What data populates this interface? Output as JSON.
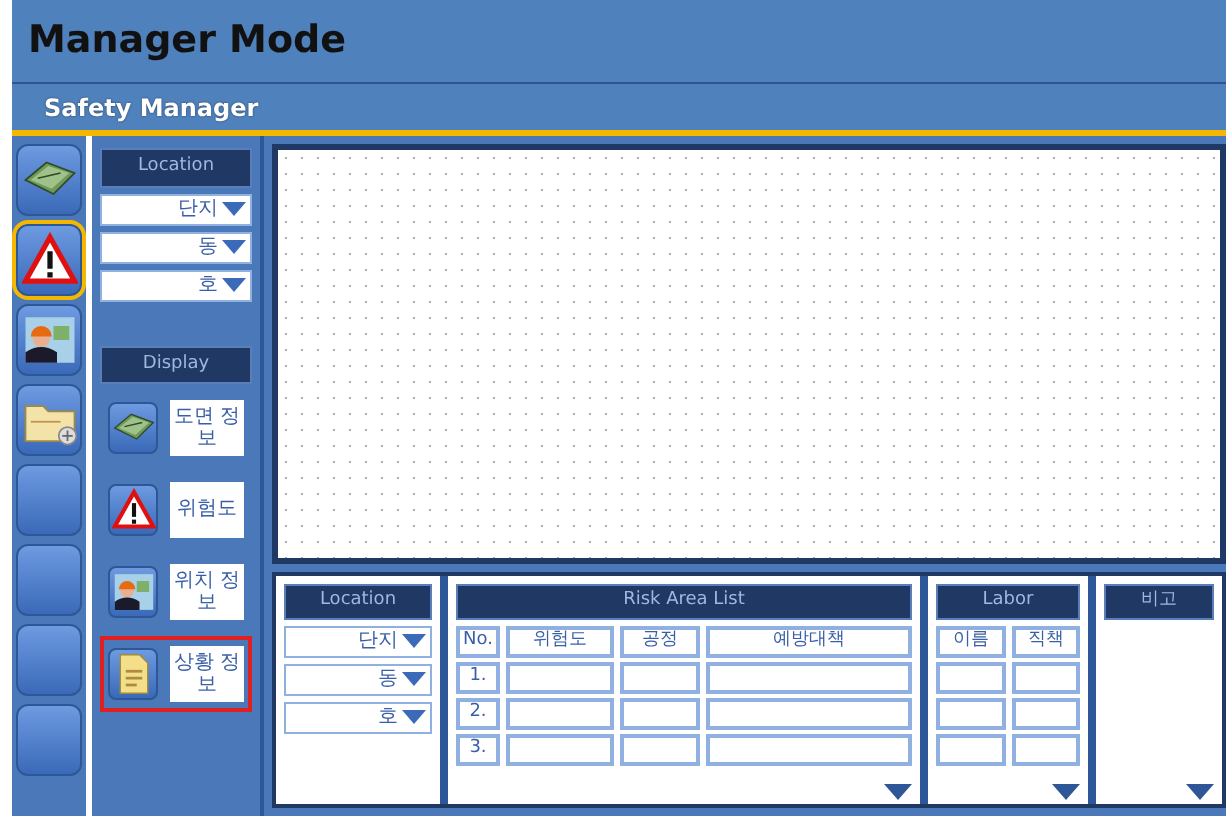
{
  "header": {
    "title": "Manager Mode",
    "subtitle": "Safety Manager"
  },
  "rail": [
    {
      "kind": "blueprint",
      "selected": false
    },
    {
      "kind": "warning",
      "selected": true
    },
    {
      "kind": "worker",
      "selected": false
    },
    {
      "kind": "folder",
      "selected": false
    },
    {
      "kind": "blank",
      "selected": false
    },
    {
      "kind": "blank",
      "selected": false
    },
    {
      "kind": "blank",
      "selected": false
    },
    {
      "kind": "blank",
      "selected": false
    }
  ],
  "side_panel": {
    "location": {
      "title": "Location",
      "dropdowns": [
        "단지",
        "동",
        "호"
      ]
    },
    "display": {
      "title": "Display",
      "items": [
        {
          "kind": "blueprint",
          "label": "도면 정보",
          "selected": false
        },
        {
          "kind": "warning",
          "label": "위험도",
          "selected": false
        },
        {
          "kind": "worker",
          "label": "위치 정보",
          "selected": false
        },
        {
          "kind": "document",
          "label": "상황 정보",
          "selected": true
        }
      ]
    }
  },
  "bottom": {
    "location": {
      "title": "Location",
      "dropdowns": [
        "단지",
        "동",
        "호"
      ]
    },
    "risk_list": {
      "title": "Risk Area List",
      "columns": [
        "No.",
        "위험도",
        "공정",
        "예방대책"
      ],
      "rows": [
        "1.",
        "2.",
        "3."
      ]
    },
    "labor": {
      "title": "Labor",
      "columns": [
        "이름",
        "직책"
      ]
    },
    "remarks": {
      "title": "비고"
    }
  }
}
